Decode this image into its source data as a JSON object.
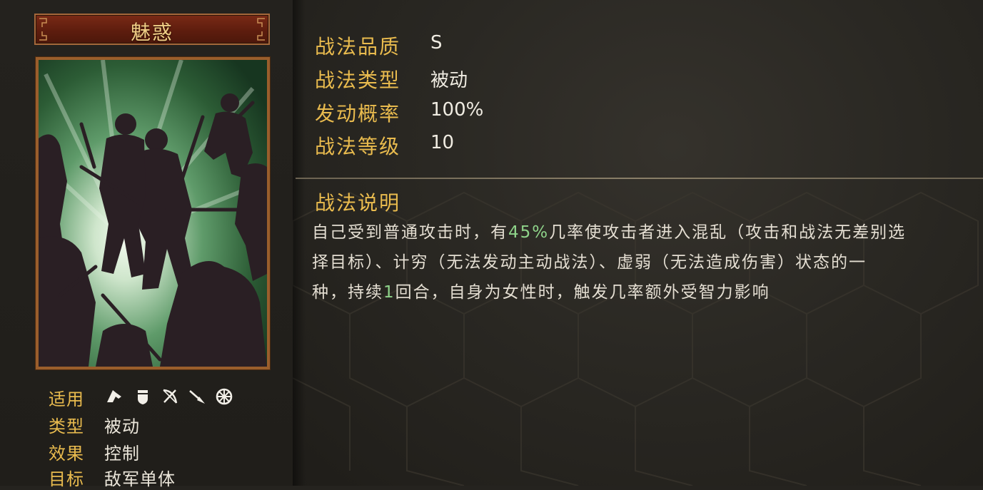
{
  "skill": {
    "name": "魅惑"
  },
  "attributes": {
    "applicable_label": "适用",
    "applicable_icons": [
      "cavalry-icon",
      "shield-infantry-icon",
      "archer-icon",
      "spear-icon",
      "siege-wheel-icon"
    ],
    "type_label": "类型",
    "type_value": "被动",
    "effect_label": "效果",
    "effect_value": "控制",
    "target_label": "目标",
    "target_value": "敌军单体"
  },
  "info": {
    "quality_label": "战法品质",
    "quality_value": "S",
    "kind_label": "战法类型",
    "kind_value": "被动",
    "rate_label": "发动概率",
    "rate_value": "100%",
    "level_label": "战法等级",
    "level_value": "10"
  },
  "description": {
    "title": "战法说明",
    "line1_a": "自己受到普通攻击时，有",
    "line1_hl": "45%",
    "line1_b": "几率使攻击者进入混乱（攻击和战法无差别选",
    "line2": "择目标）、计穷（无法发动主动战法）、虚弱（无法造成伤害）状态的一",
    "line3_a": "种，持续",
    "line3_hl": "1",
    "line3_b": "回合，自身为女性时，触发几率额外受智力影响"
  },
  "colors": {
    "label_gold": "#e9bb4e",
    "highlight_green": "#8fd48a",
    "banner_red": "#6a2312",
    "frame_bronze": "#9a5e2c"
  }
}
